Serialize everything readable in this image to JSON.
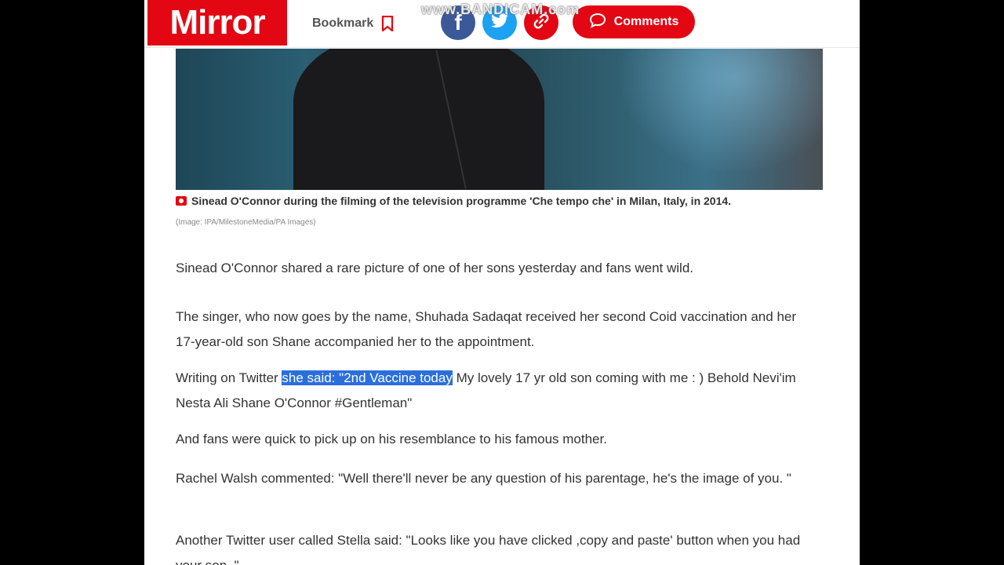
{
  "header": {
    "logo_text": "Mirror",
    "bookmark_label": "Bookmark",
    "comments_label": "Comments",
    "watermark": "www.BANDICAM.com"
  },
  "share": {
    "facebook_glyph": "f"
  },
  "image": {
    "caption": "Sinead O'Connor during the filming of the television programme 'Che tempo che' in Milan, Italy, in 2014.",
    "credit": "(Image: IPA/MilestoneMedia/PA Images)"
  },
  "article": {
    "p1": "Sinead O'Connor shared a rare picture of one of her sons yesterday and fans went wild.",
    "p2": "The singer, who now goes by the name, Shuhada Sadaqat received her second Coid vaccination and her 17-year-old son Shane accompanied her to the appointment.",
    "p3_before": "Writing on Twitter ",
    "p3_highlight": "she said: \"2nd Vaccine today",
    "p3_after": " My lovely 17 yr old son coming with me : ) Behold Nevi'im Nesta Ali Shane O'Connor #Gentleman\"",
    "p4": "And fans were quick to pick up on his resemblance to his famous mother.",
    "p5": "Rachel Walsh commented: \"Well there'll never be any question of his parentage, he's the image of you. \"",
    "p6": "Another Twitter user called Stella said: \"Looks like you have clicked ,copy and paste' button when you had your son. \""
  },
  "colors": {
    "brand_red": "#e30613",
    "facebook_blue": "#3b5998",
    "twitter_blue": "#1da1f2",
    "selection_blue": "#2a6fdc"
  },
  "icons": [
    "bookmark-icon",
    "facebook-icon",
    "twitter-icon",
    "link-icon",
    "comment-icon",
    "camera-icon"
  ]
}
